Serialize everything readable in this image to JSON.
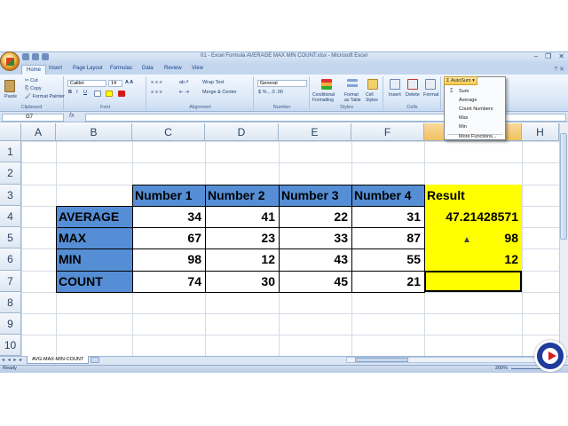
{
  "window": {
    "title": "01 - Excel Formula AVERAGE MAX MIN COUNT.xlsx - Microsoft Excel"
  },
  "ribbon": {
    "tabs": [
      "Home",
      "Insert",
      "Page Layout",
      "Formulas",
      "Data",
      "Review",
      "View"
    ],
    "active_tab": "Home",
    "clipboard": {
      "paste": "Paste",
      "cut": "Cut",
      "copy": "Copy",
      "format_painter": "Format Painter",
      "label": "Clipboard"
    },
    "font": {
      "name": "Calibri",
      "size": "14",
      "label": "Font"
    },
    "alignment": {
      "wrap_text": "Wrap Text",
      "merge_center": "Merge & Center",
      "label": "Alignment"
    },
    "number": {
      "format": "General",
      "label": "Number"
    },
    "styles": {
      "conditional": "Conditional Formatting",
      "format_table": "Format as Table",
      "cell_styles": "Cell Styles",
      "label": "Styles"
    },
    "cells": {
      "insert": "Insert",
      "delete": "Delete",
      "format": "Format",
      "label": "Cells"
    },
    "editing": {
      "autosum": "AutoSum"
    }
  },
  "autosum_menu": {
    "items": [
      "Sum",
      "Average",
      "Count Numbers",
      "Max",
      "Min"
    ],
    "more": "More Functions..."
  },
  "formula_bar": {
    "name_box": "G7",
    "fx": "fx",
    "value": ""
  },
  "grid": {
    "columns": [
      "A",
      "B",
      "C",
      "D",
      "E",
      "F",
      "G",
      "H"
    ],
    "rows": [
      "1",
      "2",
      "3",
      "4",
      "5",
      "6",
      "7",
      "8",
      "9",
      "10"
    ],
    "header_row": [
      "Number 1",
      "Number 2",
      "Number 3",
      "Number 4",
      "Result"
    ],
    "data_rows": [
      {
        "label": "AVERAGE",
        "values": [
          "34",
          "41",
          "22",
          "31"
        ],
        "result": "47.21428571"
      },
      {
        "label": "MAX",
        "values": [
          "67",
          "23",
          "33",
          "87"
        ],
        "result": "98"
      },
      {
        "label": "MIN",
        "values": [
          "98",
          "12",
          "43",
          "55"
        ],
        "result": "12"
      },
      {
        "label": "COUNT",
        "values": [
          "74",
          "30",
          "45",
          "21"
        ],
        "result": ""
      }
    ]
  },
  "sheet": {
    "nav": "◂ ◂ ▸ ▸",
    "tab_name": "AVG-MAX-MIN-COUNT"
  },
  "status": {
    "text": "Ready",
    "zoom": "200%"
  }
}
